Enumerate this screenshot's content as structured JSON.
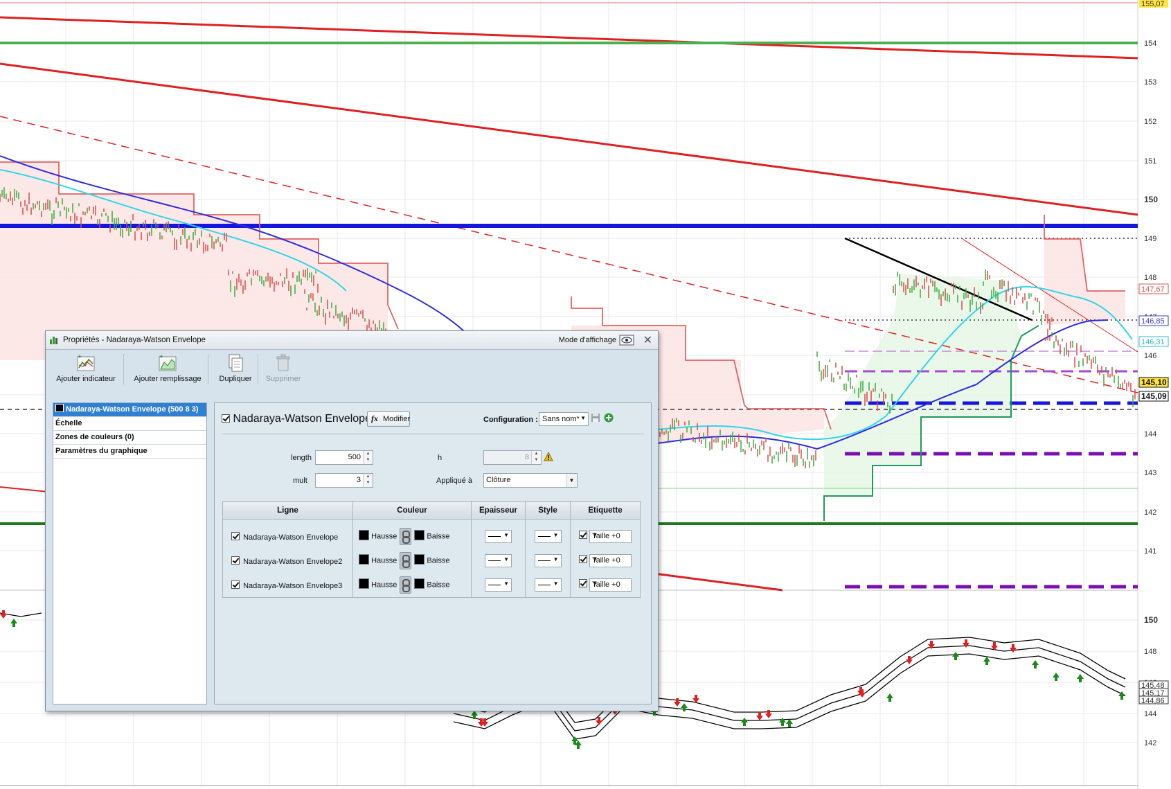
{
  "chart": {
    "main_axis_ticks": [
      "154",
      "153",
      "152",
      "151",
      "150",
      "149",
      "148",
      "147",
      "146",
      "145",
      "144",
      "143",
      "142",
      "141"
    ],
    "top_price_label": "155,07",
    "price_labels": [
      {
        "text": "147,67",
        "color": "#d9534f"
      },
      {
        "text": "146,85",
        "color": "#3a3fcf"
      },
      {
        "text": "146,31",
        "color": "#2bbbd0"
      },
      {
        "text": "145,10",
        "color": "#111111"
      },
      {
        "text": "145,09",
        "color": "#111111"
      }
    ],
    "lower_axis_ticks": [
      "150",
      "148",
      "146",
      "144",
      "142"
    ],
    "lower_price_labels": [
      "145,48",
      "145,17",
      "144,86"
    ],
    "colors": {
      "red": "#e02020",
      "blue": "#1515e0",
      "green": "#1b7a1b",
      "cyan": "#2fd6e8",
      "purple": "#8a1ab0",
      "pink_fill": "#fde4e4",
      "yellow_highlight": "#e6e600",
      "price_highlight": "#ffe53b"
    }
  },
  "dialog": {
    "title": "Propriétés - Nadaraya-Watson Envelope",
    "display_mode": "Mode d'affichage",
    "toolbar": {
      "add_indicator": "Ajouter indicateur",
      "add_fill": "Ajouter remplissage",
      "duplicate": "Dupliquer",
      "delete": "Supprimer"
    },
    "left_items": [
      "Nadaraya-Watson Envelope (500 8 3)",
      "Échelle",
      "Zones de couleurs (0)",
      "Paramètres du graphique"
    ],
    "indicator_name": "Nadaraya-Watson Envelope",
    "modify_button": "Modifier",
    "configuration_label": "Configuration :",
    "configuration_value": "Sans nom*",
    "params": {
      "length_label": "length",
      "length_value": "500",
      "mult_label": "mult",
      "mult_value": "3",
      "h_label": "h",
      "h_value": "8",
      "applied_label": "Appliqué à",
      "applied_value": "Clôture"
    },
    "table": {
      "headers": [
        "Ligne",
        "Couleur",
        "Epaisseur",
        "Style",
        "Etiquette"
      ],
      "rows": [
        {
          "name": "Nadaraya-Watson Envelope",
          "up": "Hausse",
          "down": "Baisse",
          "label": "Taille +0"
        },
        {
          "name": "Nadaraya-Watson Envelope2",
          "up": "Hausse",
          "down": "Baisse",
          "label": "Taille +0"
        },
        {
          "name": "Nadaraya-Watson Envelope3",
          "up": "Hausse",
          "down": "Baisse",
          "label": "Taille +0"
        }
      ]
    }
  }
}
